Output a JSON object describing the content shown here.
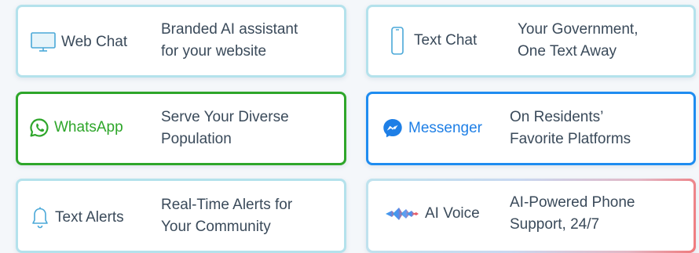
{
  "cards": [
    {
      "label": "Web Chat",
      "desc_line1": "Branded AI assistant",
      "desc_line2": "for your website",
      "icon": "monitor-icon"
    },
    {
      "label": "Text Chat",
      "desc_line1": "Your Government,",
      "desc_line2": "One Text Away",
      "icon": "phone-icon"
    },
    {
      "label": "WhatsApp",
      "desc_line1": "Serve Your Diverse",
      "desc_line2": "Population",
      "icon": "whatsapp-icon"
    },
    {
      "label": "Messenger",
      "desc_line1": "On Residents’",
      "desc_line2": "Favorite Platforms",
      "icon": "messenger-icon"
    },
    {
      "label": "Text Alerts",
      "desc_line1": "Real-Time Alerts for",
      "desc_line2": "Your Community",
      "icon": "bell-icon"
    },
    {
      "label": "AI Voice",
      "desc_line1": "AI-Powered Phone",
      "desc_line2": "Support, 24/7",
      "icon": "voice-waveform-icon"
    }
  ],
  "colors": {
    "whatsapp": "#2ea62a",
    "messenger": "#1e8cf0",
    "card_border": "#c6e9f2",
    "text": "#3a4a5a"
  }
}
